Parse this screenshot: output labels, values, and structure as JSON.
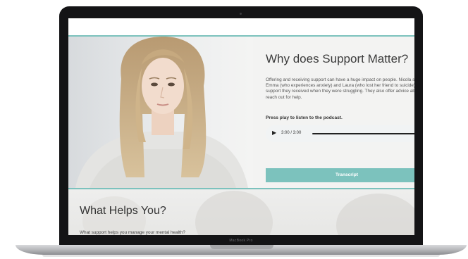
{
  "device": {
    "brand_label": "MacBook Pro"
  },
  "hero": {
    "title": "Why does Support Matter?",
    "body": "Offering and receiving support can have a huge impact on people. Nicola speaks to Emma (who experiences anxiety) and Laura (who lost her friend to suicide) about the support they received when they were struggling. They also offer advice about how to reach out for help.",
    "press_play": "Press play to listen to the podcast.",
    "player": {
      "play_symbol": "▶",
      "time": "3:00 / 3:00",
      "progress": 1.0
    },
    "transcript_label": "Transcript"
  },
  "helps": {
    "title": "What Helps You?",
    "question": "What support helps you manage your mental health?"
  },
  "colors": {
    "accent": "#7cc2bd",
    "bezel": "#141416",
    "title_text": "#3b3b3b"
  }
}
